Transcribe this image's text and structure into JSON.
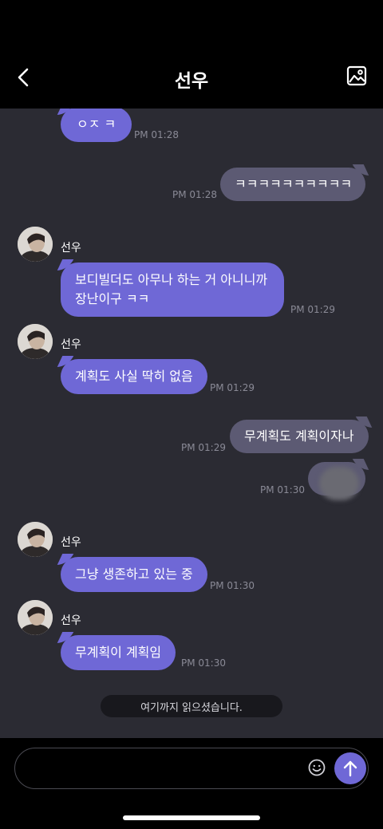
{
  "header": {
    "title": "선우",
    "back_icon": "chevron-left-icon",
    "gallery_icon": "image-icon"
  },
  "messages": [
    {
      "dir": "in",
      "text": "ㅇㅈ ㅋ",
      "time": "PM 01:28"
    },
    {
      "dir": "out",
      "text": "ㅋㅋㅋㅋㅋㅋㅋㅋㅋㅋ",
      "time": "PM 01:28"
    },
    {
      "dir": "in",
      "sender": "선우",
      "text1": "보디빌더도 아무나 하는 거 아니니까",
      "text2": "장난이구 ㅋㅋ",
      "time": "PM 01:29"
    },
    {
      "dir": "in",
      "sender": "선우",
      "text": "계획도 사실 딱히 없음",
      "time": "PM 01:29"
    },
    {
      "dir": "out",
      "text": "무계획도 계획이자나",
      "time": "PM 01:29"
    },
    {
      "dir": "out",
      "text": "",
      "time": "PM 01:30"
    },
    {
      "dir": "in",
      "sender": "선우",
      "text": "그냥 생존하고 있는 중",
      "time": "PM 01:30"
    },
    {
      "dir": "in",
      "sender": "선우",
      "text": "무계획이 계획임",
      "time": "PM 01:30"
    }
  ],
  "read_divider": "여기까지 읽으셨습니다.",
  "composer": {
    "value": "",
    "placeholder": "",
    "emoji_icon": "smiley-icon",
    "send_icon": "arrow-up-icon"
  },
  "colors": {
    "incoming": "#6f68d6",
    "outgoing": "#5c5a73",
    "background": "#2b2b33",
    "send": "#6f68d6"
  }
}
